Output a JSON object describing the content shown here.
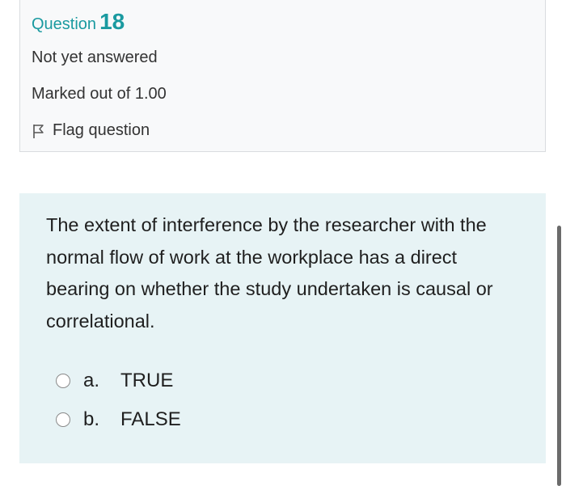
{
  "question_info": {
    "label": "Question",
    "number": "18",
    "state": "Not yet answered",
    "grade": "Marked out of 1.00",
    "flag_label": "Flag question"
  },
  "question": {
    "text": "The extent of interference by the researcher with the normal flow of work at the workplace has a direct bearing on whether the study undertaken is causal or correlational.",
    "answers": [
      {
        "letter": "a.",
        "label": "TRUE",
        "selected": false
      },
      {
        "letter": "b.",
        "label": "FALSE",
        "selected": false
      }
    ]
  },
  "colors": {
    "accent": "#1a9aa0",
    "info_background": "#f8f9fa",
    "question_background": "#e7f3f5",
    "text": "#333333"
  },
  "icons": {
    "flag": "flag-outline-icon",
    "radio": "radio-unchecked"
  }
}
